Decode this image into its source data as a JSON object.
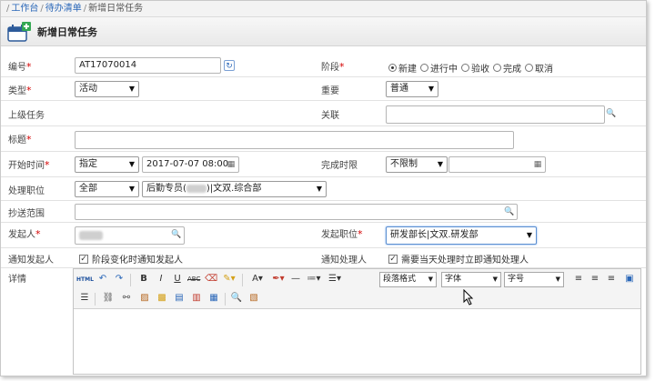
{
  "breadcrumb": {
    "home": "工作台",
    "todo": "待办清单",
    "current": "新增日常任务"
  },
  "page_title": "新增日常任务",
  "form": {
    "code_label": "编号",
    "code_value": "AT17070014",
    "stage_label": "阶段",
    "stage_options": [
      "新建",
      "进行中",
      "验收",
      "完成",
      "取消"
    ],
    "type_label": "类型",
    "type_value": "活动",
    "importance_label": "重要",
    "importance_value": "普通",
    "parent_task_label": "上级任务",
    "related_label": "关联",
    "title_label": "标题",
    "start_time_label": "开始时间",
    "start_mode_value": "指定",
    "start_time_value": "2017-07-07 08:00",
    "deadline_label": "完成时限",
    "deadline_value": "不限制",
    "handler_position_label": "处理职位",
    "handler_scope_value": "全部",
    "handler_position_prefix": "后勤专员(",
    "handler_position_suffix": ")|文双.综合部",
    "cc_label": "抄送范围",
    "initiator_label": "发起人",
    "initiator_position_label": "发起职位",
    "initiator_position_value": "研发部长|文双.研发部",
    "notify_initiator_label": "通知发起人",
    "notify_initiator_check": "阶段变化时通知发起人",
    "notify_handler_label": "通知处理人",
    "notify_handler_check": "需要当天处理时立即通知处理人",
    "details_label": "详情"
  },
  "editor_toolbar": {
    "html_label": "HTML",
    "paragraph_format": "段落格式",
    "font": "字体",
    "font_size": "字号"
  }
}
